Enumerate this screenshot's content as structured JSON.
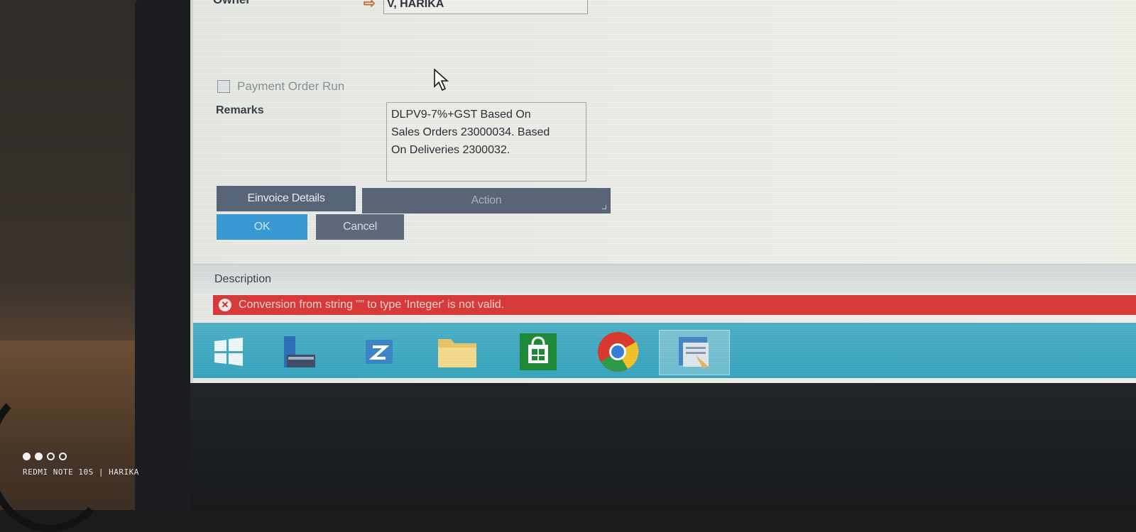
{
  "form": {
    "owner_label": "Owner",
    "owner_value": "V, HARIKA",
    "payment_order_run_label": "Payment Order Run",
    "remarks_label": "Remarks",
    "remarks_value": "DLPV9-7%+GST Based On\nSales Orders 23000034. Based\nOn Deliveries 2300032."
  },
  "buttons": {
    "einvoice": "Einvoice Details",
    "action": "Action",
    "ok": "OK",
    "cancel": "Cancel"
  },
  "status": {
    "description_label": "Description",
    "error_message": "Conversion from string \"\" to type 'Integer' is not valid."
  },
  "taskbar": {
    "icons": [
      "windows-start-icon",
      "file-manager-icon",
      "app-icon",
      "folder-icon",
      "store-icon",
      "chrome-icon",
      "sap-business-one-icon"
    ]
  },
  "watermark": {
    "text": "REDMI NOTE 10S | HARIKA"
  },
  "colors": {
    "error_bar": "#d93b3b",
    "ok_button": "#3a9ad4",
    "taskbar": "#3aa6c0"
  }
}
